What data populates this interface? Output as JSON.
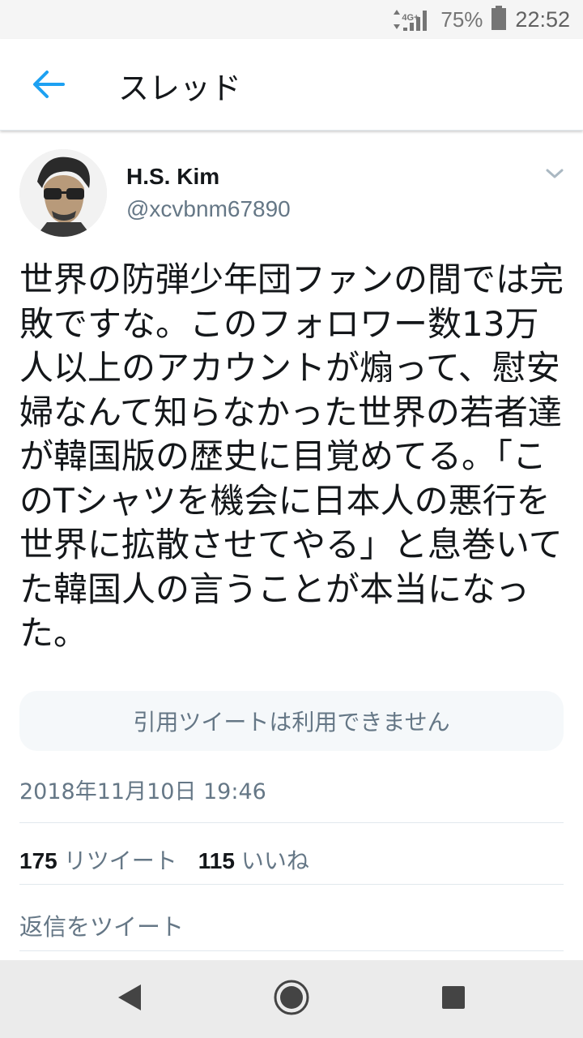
{
  "status_bar": {
    "network": "4G+",
    "battery": "75%",
    "time": "22:52"
  },
  "header": {
    "title": "スレッド"
  },
  "tweet": {
    "author_name": "H.S. Kim",
    "handle": "@xcvbnm67890",
    "text": "世界の防弾少年団ファンの間では完敗ですな。このフォロワー数13万人以上のアカウントが煽って、慰安婦なんて知らなかった世界の若者達が韓国版の歴史に目覚めてる。「このTシャツを機会に日本人の悪行を世界に拡散させてやる」と息巻いてた韓国人の言うことが本当になった。",
    "quote_unavailable": "引用ツイートは利用できません",
    "timestamp": "2018年11月10日 19:46",
    "retweet_count": "175",
    "retweet_label": "リツイート",
    "like_count": "115",
    "like_label": "いいね",
    "reply_prompt": "返信をツイート"
  },
  "colors": {
    "accent": "#1da1f2",
    "secondary_text": "#657786",
    "divider": "#e1e8ed"
  },
  "icons": {
    "back": "arrow-left-icon",
    "caret": "chevron-down-icon",
    "nav_back": "triangle-back-icon",
    "nav_home": "circle-home-icon",
    "nav_recent": "square-recent-icon"
  }
}
